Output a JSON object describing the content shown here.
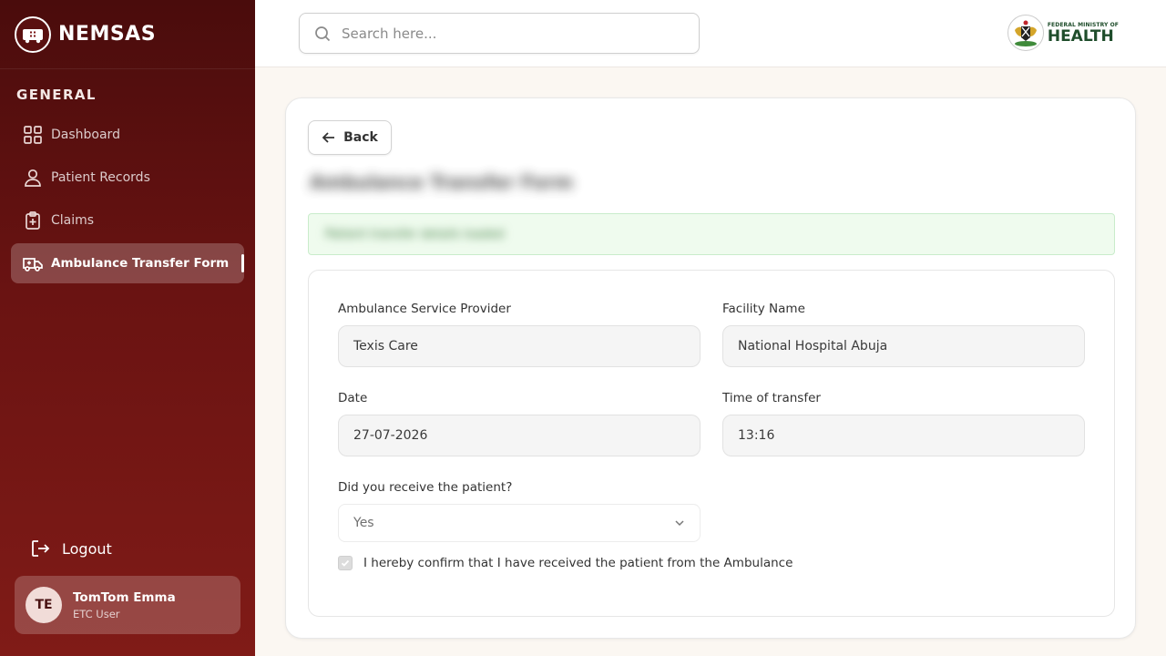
{
  "brand": {
    "name": "NEMSAS",
    "logo_icon": "ambulance-logo-icon"
  },
  "sidebar": {
    "section_label": "GENERAL",
    "items": [
      {
        "label": "Dashboard",
        "icon": "grid-icon",
        "active": false
      },
      {
        "label": "Patient Records",
        "icon": "user-icon",
        "active": false
      },
      {
        "label": "Claims",
        "icon": "clipboard-plus-icon",
        "active": false
      },
      {
        "label": "Ambulance Transfer Form",
        "icon": "ambulance-icon",
        "active": true
      }
    ],
    "logout_label": "Logout",
    "user": {
      "initials": "TE",
      "name": "TomTom Emma",
      "role": "ETC User"
    }
  },
  "topbar": {
    "search_placeholder": "Search here...",
    "ministry_small": "FEDERAL MINISTRY OF",
    "ministry_big": "HEALTH"
  },
  "main": {
    "back_label": "Back",
    "page_title": "Ambulance Transfer Form",
    "notice": "Patient transfer details loaded"
  },
  "form": {
    "provider_label": "Ambulance Service Provider",
    "provider_value": "Texis Care",
    "facility_label": "Facility Name",
    "facility_value": "National Hospital Abuja",
    "date_label": "Date",
    "date_value": "27-07-2026",
    "time_label": "Time of transfer",
    "time_value": "13:16",
    "received_label": "Did you receive the patient?",
    "received_value": "Yes",
    "confirm_label": "I hereby confirm that I have received the patient from the Ambulance",
    "confirm_checked": true
  },
  "colors": {
    "sidebar_top": "#4a0c0c",
    "sidebar_bottom": "#801b17",
    "notice_bg": "#effbee",
    "ministry_green": "#1f4d2b"
  }
}
